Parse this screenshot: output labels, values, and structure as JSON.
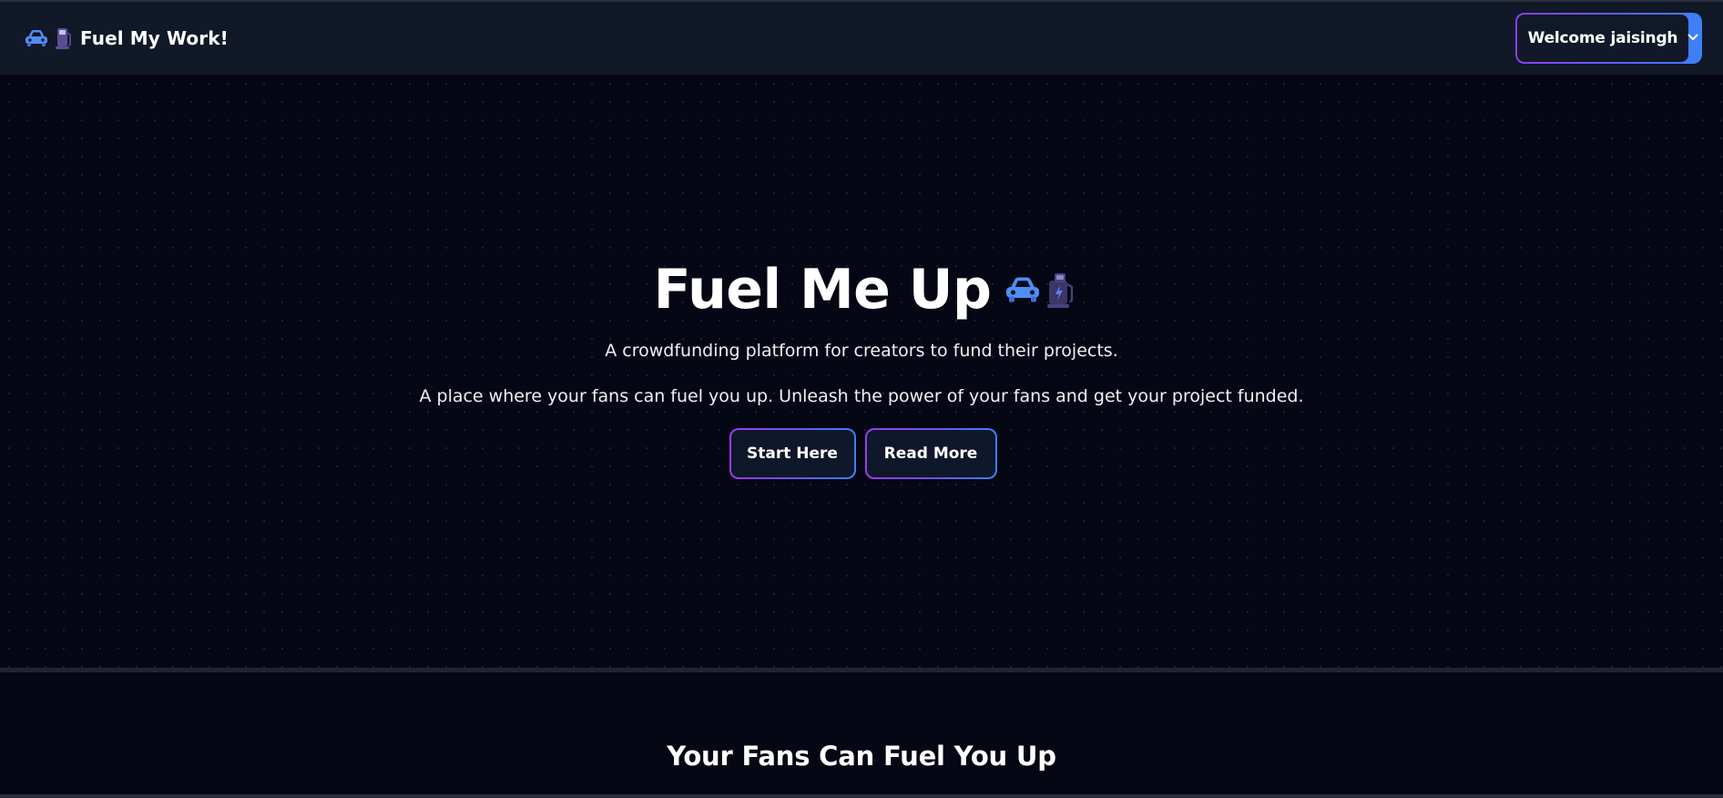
{
  "navbar": {
    "brand_title": "Fuel My Work!",
    "brand_icons": [
      "car-icon",
      "fuel-pump-icon"
    ],
    "welcome_label": "Welcome jaisingh",
    "welcome_menu_icon": "chevron-down-icon"
  },
  "hero": {
    "title": "Fuel Me Up",
    "title_icons": [
      "car-icon",
      "fuel-pump-icon"
    ],
    "tagline": "A crowdfunding platform for creators to fund their projects.",
    "description": "A place where your fans can fuel you up. Unleash the power of your fans and get your project funded.",
    "start_label": "Start Here",
    "read_label": "Read More"
  },
  "section2": {
    "title": "Your Fans Can Fuel You Up"
  },
  "colors": {
    "background": "#050714",
    "navbar": "#111827",
    "gradient_start": "#9b3cf0",
    "gradient_end": "#3b82f6",
    "car_blue": "#4f8df5",
    "pump_purple": "#6b5aa8"
  }
}
